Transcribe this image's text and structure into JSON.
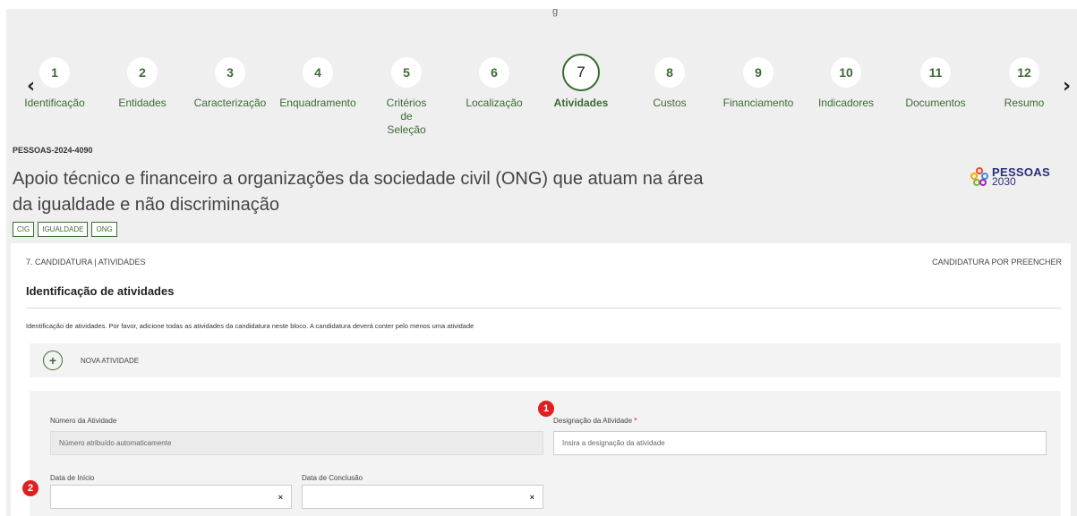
{
  "top_fragment": "g",
  "stepper": {
    "steps": [
      {
        "number": "1",
        "label": "Identificação"
      },
      {
        "number": "2",
        "label": "Entidades"
      },
      {
        "number": "3",
        "label": "Caracterização"
      },
      {
        "number": "4",
        "label": "Enquadramento"
      },
      {
        "number": "5",
        "label": "Critérios de Seleção"
      },
      {
        "number": "6",
        "label": "Localização"
      },
      {
        "number": "7",
        "label": "Atividades"
      },
      {
        "number": "8",
        "label": "Custos"
      },
      {
        "number": "9",
        "label": "Financiamento"
      },
      {
        "number": "10",
        "label": "Indicadores"
      },
      {
        "number": "11",
        "label": "Documentos"
      },
      {
        "number": "12",
        "label": "Resumo"
      }
    ],
    "active_step": 7,
    "prev_icon": "chevron-left-icon",
    "next_icon": "chevron-right-icon"
  },
  "project": {
    "code": "PESSOAS-2024-4090",
    "title": "Apoio técnico e financeiro a organizações da sociedade civil (ONG) que atuam na área da igualdade e não discriminação",
    "tags": [
      "CIG",
      "IGUALDADE",
      "ONG"
    ],
    "logo": {
      "word": "PESSOAS",
      "year": "2030"
    }
  },
  "card": {
    "breadcrumb": "7. CANDIDATURA | ATIVIDADES",
    "status": "CANDIDATURA POR PREENCHER",
    "section_title": "Identificação de atividades",
    "description": "Identificação de atividades. Por favor, adicione todas as atividades da candidatura neste bloco. A candidatura deverá conter pelo menos uma atividade",
    "new_activity_label": "NOVA ATIVIDADE",
    "form": {
      "number_label": "Número da Atividade",
      "number_value": "Número atribuído automaticamente",
      "designation_label": "Designação da Atividade",
      "designation_required": "*",
      "designation_placeholder": "Insira a designação da atividade",
      "start_label": "Data de Início",
      "end_label": "Data de Conclusão",
      "clear_glyph": "×"
    }
  },
  "markers": {
    "m1": "1",
    "m2": "2"
  },
  "colors": {
    "accent": "#3c6b33",
    "marker": "#e02020",
    "logo": "#2a2f7a"
  }
}
